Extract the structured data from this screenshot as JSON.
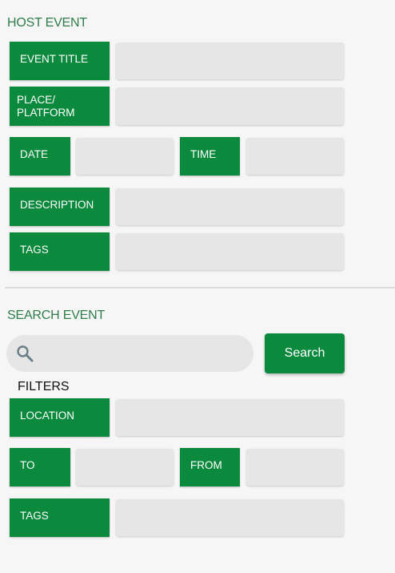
{
  "host_event": {
    "title": "HOST EVENT",
    "event_title_label": "EVENT TITLE",
    "event_title_value": "",
    "place_label": "PLACE/ PLATFORM",
    "place_value": "",
    "date_label": "DATE",
    "date_value": "",
    "time_label": "TIME",
    "time_value": "",
    "description_label": "DESCRIPTION",
    "description_value": "",
    "tags_label": "TAGS",
    "tags_value": ""
  },
  "search_event": {
    "title": "SEARCH EVENT",
    "search_value": "",
    "search_button_label": "Search",
    "search_icon": "search-icon",
    "filters_title": "FILTERS",
    "location_label": "LOCATION",
    "location_value": "",
    "to_label": "TO",
    "to_value": "",
    "from_label": "FROM",
    "from_value": "",
    "tags_label": "TAGS",
    "tags_value": ""
  },
  "colors": {
    "accent": "#0b8a3e",
    "section_title": "#2e7d4a",
    "field_bg": "#e6e6e6",
    "page_bg": "#f6f6f6"
  }
}
